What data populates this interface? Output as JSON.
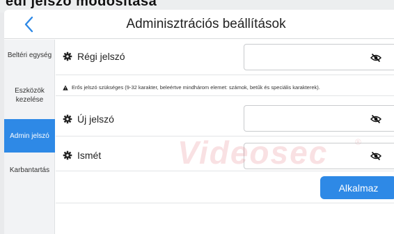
{
  "top_strip_text": "edi jelszó módosítása",
  "header": {
    "title": "Adminisztrációs beállítások"
  },
  "sidebar": {
    "items": [
      {
        "label": "Beltéri egység",
        "active": false
      },
      {
        "label": "Eszközök kezelése",
        "active": false
      },
      {
        "label": "Admin jelszó",
        "active": true
      },
      {
        "label": "Karbantartás",
        "active": false
      }
    ]
  },
  "form": {
    "old_password_label": "Régi jelszó",
    "old_password_value": "",
    "warning": "Erős jelszó szükséges (9-32 karakter, beleértve mindhárom elemet: számok, betűk és speciális karakterek).",
    "new_password_label": "Új jelszó",
    "new_password_value": "",
    "repeat_label": "Ismét",
    "repeat_value": "",
    "apply_label": "Alkalmaz"
  },
  "watermark": {
    "text": "Videosec",
    "mark": "®"
  },
  "colors": {
    "accent": "#2e89e6",
    "sidebar_bg": "#f2f3f5",
    "border": "#c9cbce"
  },
  "icons": {
    "back": "chevron-left-icon",
    "gear": "gear-icon",
    "eye": "eye-slash-icon",
    "warning": "warning-icon"
  }
}
